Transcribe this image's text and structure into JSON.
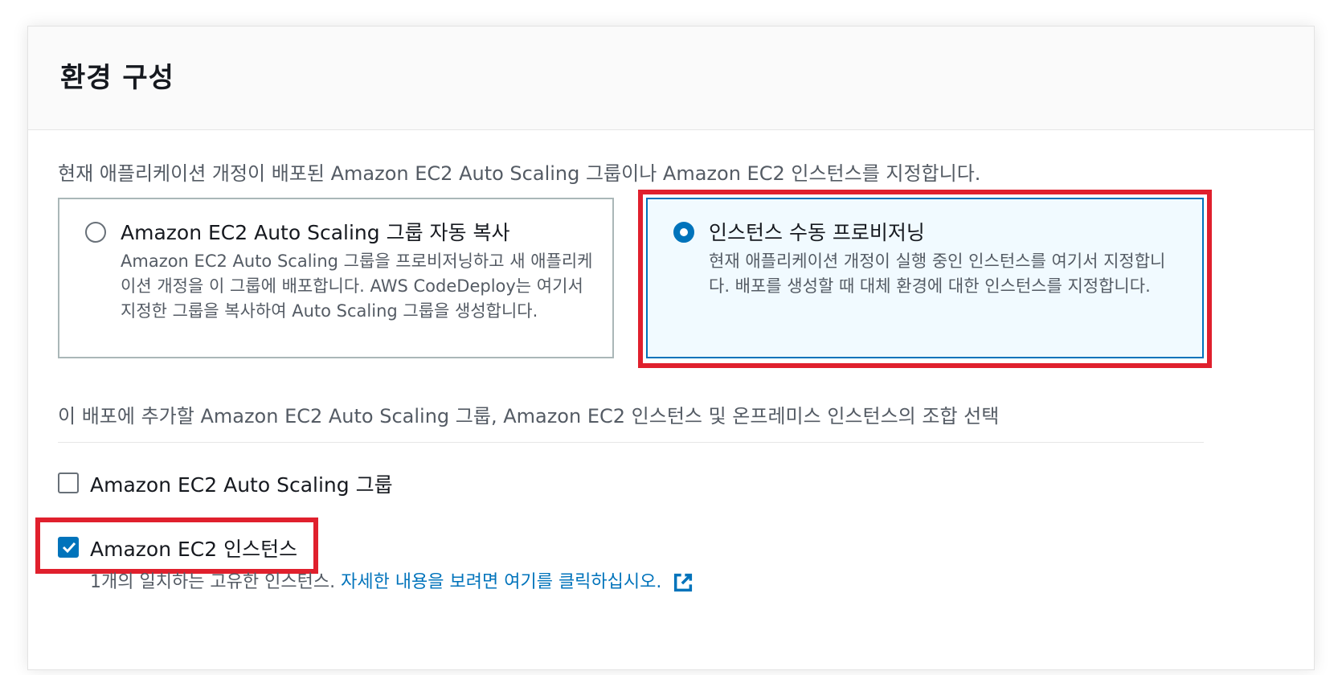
{
  "section": {
    "title": "환경 구성",
    "description": "현재 애플리케이션 개정이 배포된 Amazon EC2 Auto Scaling 그룹이나 Amazon EC2 인스턴스를 지정합니다."
  },
  "options": [
    {
      "title": "Amazon EC2 Auto Scaling 그룹 자동 복사",
      "description": "Amazon EC2 Auto Scaling 그룹을 프로비저닝하고 새 애플리케이션 개정을 이 그룹에 배포합니다. AWS CodeDeploy는 여기서 지정한 그룹을 복사하여 Auto Scaling 그룹을 생성합니다.",
      "selected": false
    },
    {
      "title": "인스턴스 수동 프로비저닝",
      "description": "현재 애플리케이션 개정이 실행 중인 인스턴스를 여기서 지정합니다. 배포를 생성할 때 대체 환경에 대한 인스턴스를 지정합니다.",
      "selected": true
    }
  ],
  "combination": {
    "label": "이 배포에 추가할 Amazon EC2 Auto Scaling 그룹, Amazon EC2 인스턴스 및 온프레미스 인스턴스의 조합 선택",
    "checkboxes": [
      {
        "label": "Amazon EC2 Auto Scaling 그룹",
        "checked": false
      },
      {
        "label": "Amazon EC2 인스턴스",
        "checked": true
      }
    ],
    "hint": "1개의 일치하는 고유한 인스턴스.",
    "link": "자세한 내용을 보려면 여기를 클릭하십시오."
  },
  "colors": {
    "accent": "#0073bb",
    "highlight": "#e0202d"
  },
  "icons": {
    "external_link": "external-link-icon"
  }
}
